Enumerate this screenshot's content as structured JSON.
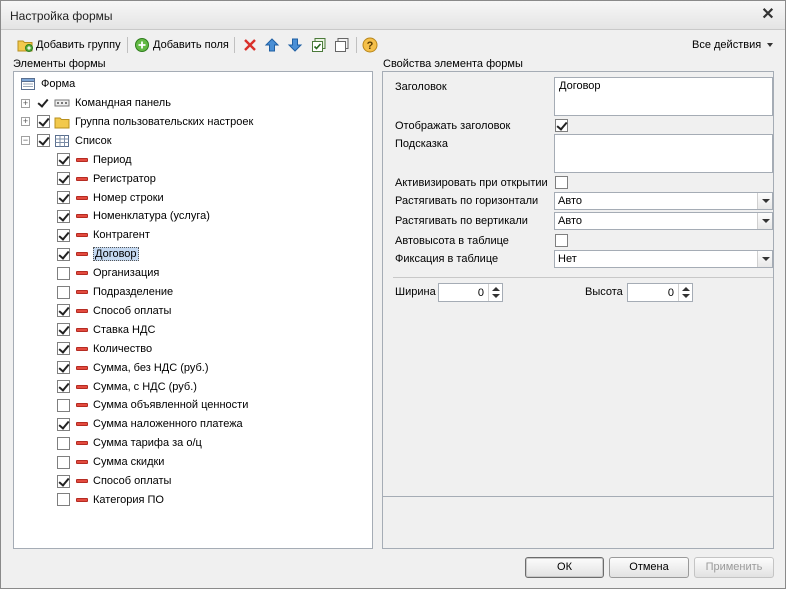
{
  "window": {
    "title": "Настройка формы"
  },
  "toolbar": {
    "add_group_label": "Добавить группу",
    "add_fields_label": "Добавить поля",
    "all_actions_label": "Все действия"
  },
  "left": {
    "header": "Элементы формы",
    "root": {
      "label": "Форма"
    },
    "items": [
      {
        "label": "Командная панель",
        "checked": true,
        "level": 1,
        "kind": "panel",
        "expander": "+"
      },
      {
        "label": "Группа пользовательских настроек",
        "checked": true,
        "level": 1,
        "kind": "folder",
        "expander": "+"
      },
      {
        "label": "Список",
        "checked": true,
        "level": 1,
        "kind": "table",
        "expander": "−"
      },
      {
        "label": "Период",
        "checked": true,
        "level": 2
      },
      {
        "label": "Регистратор",
        "checked": true,
        "level": 2
      },
      {
        "label": "Номер строки",
        "checked": true,
        "level": 2
      },
      {
        "label": "Номенклатура (услуга)",
        "checked": true,
        "level": 2
      },
      {
        "label": "Контрагент",
        "checked": true,
        "level": 2
      },
      {
        "label": "Договор",
        "checked": true,
        "level": 2,
        "selected": true
      },
      {
        "label": "Организация",
        "checked": false,
        "level": 2
      },
      {
        "label": "Подразделение",
        "checked": false,
        "level": 2
      },
      {
        "label": "Способ оплаты",
        "checked": true,
        "level": 2
      },
      {
        "label": "Ставка НДС",
        "checked": true,
        "level": 2
      },
      {
        "label": "Количество",
        "checked": true,
        "level": 2
      },
      {
        "label": "Сумма, без НДС (руб.)",
        "checked": true,
        "level": 2
      },
      {
        "label": "Сумма, с НДС (руб.)",
        "checked": true,
        "level": 2
      },
      {
        "label": "Сумма объявленной ценности",
        "checked": false,
        "level": 2
      },
      {
        "label": "Сумма наложенного платежа",
        "checked": true,
        "level": 2
      },
      {
        "label": "Сумма тарифа за о/ц",
        "checked": false,
        "level": 2
      },
      {
        "label": "Сумма скидки",
        "checked": false,
        "level": 2
      },
      {
        "label": "Способ оплаты",
        "checked": true,
        "level": 2
      },
      {
        "label": "Категория ПО",
        "checked": false,
        "level": 2
      }
    ]
  },
  "right": {
    "header": "Свойства элемента формы",
    "title_label": "Заголовок",
    "title_value": "Договор",
    "show_title_label": "Отображать заголовок",
    "show_title_checked": true,
    "tooltip_label": "Подсказка",
    "tooltip_value": "",
    "activate_label": "Активизировать при открытии",
    "activate_checked": false,
    "stretch_h_label": "Растягивать по горизонтали",
    "stretch_h_value": "Авто",
    "stretch_v_label": "Растягивать по вертикали",
    "stretch_v_value": "Авто",
    "autoheight_label": "Автовысота в таблице",
    "autoheight_checked": false,
    "fixation_label": "Фиксация в таблице",
    "fixation_value": "Нет",
    "width_label": "Ширина",
    "width_value": "0",
    "height_label": "Высота",
    "height_value": "0"
  },
  "buttons": {
    "ok": "ОК",
    "cancel": "Отмена",
    "apply": "Применить"
  },
  "colors": {
    "field_marker": "#e34b3f",
    "selection": "#c5d9f1"
  }
}
